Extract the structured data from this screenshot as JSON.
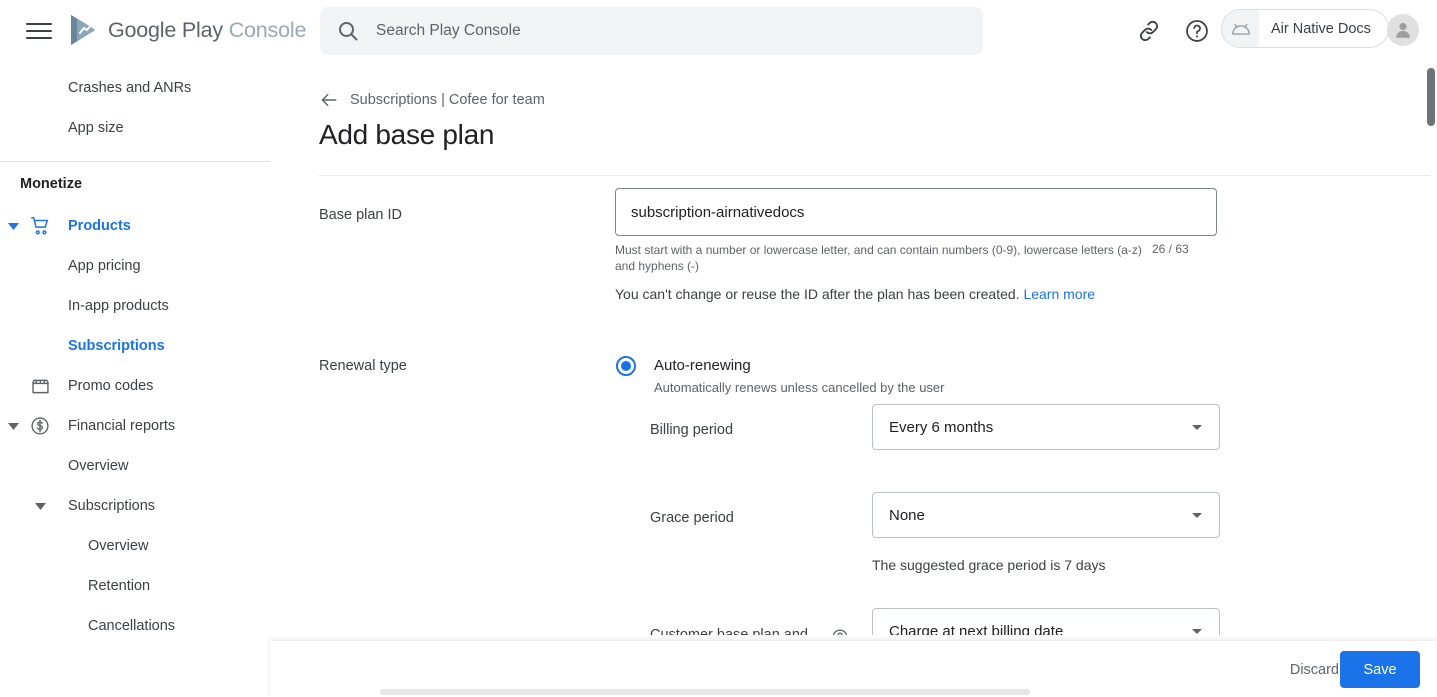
{
  "topbar": {
    "menu_icon": "hamburger-menu-icon",
    "brand_primary": "Google Play",
    "brand_secondary": "Console",
    "search": {
      "icon": "search-icon",
      "placeholder": "Search Play Console",
      "value": ""
    },
    "link_icon": "link-icon",
    "help_icon": "help-circle-icon",
    "app_chip": {
      "icon": "android-robot-icon",
      "label": "Air Native Docs"
    },
    "avatar": "user-avatar-icon"
  },
  "sidebar": {
    "top_items": [
      {
        "label": "Crashes and ANRs",
        "level": 2,
        "active": false,
        "icon": null,
        "caret": null
      },
      {
        "label": "App size",
        "level": 2,
        "active": false,
        "icon": null,
        "caret": null
      }
    ],
    "section_title": "Monetize",
    "items": [
      {
        "label": "Products",
        "level": 1,
        "active": true,
        "icon": "shopping-cart-icon",
        "caret": "expanded"
      },
      {
        "label": "App pricing",
        "level": 2,
        "active": false,
        "icon": null,
        "caret": null
      },
      {
        "label": "In-app products",
        "level": 2,
        "active": false,
        "icon": null,
        "caret": null
      },
      {
        "label": "Subscriptions",
        "level": 2,
        "active": true,
        "icon": null,
        "caret": null
      },
      {
        "label": "Promo codes",
        "level": 1,
        "active": false,
        "icon": "storefront-icon",
        "caret": null
      },
      {
        "label": "Financial reports",
        "level": 1,
        "active": false,
        "icon": "dollar-circle-icon",
        "caret": "expanded"
      },
      {
        "label": "Overview",
        "level": 2,
        "active": false,
        "icon": null,
        "caret": null
      },
      {
        "label": "Subscriptions",
        "level": 2,
        "active": false,
        "icon": null,
        "caret": "expanded-sub"
      },
      {
        "label": "Overview",
        "level": 3,
        "active": false,
        "icon": null,
        "caret": null
      },
      {
        "label": "Retention",
        "level": 3,
        "active": false,
        "icon": null,
        "caret": null
      },
      {
        "label": "Cancellations",
        "level": 3,
        "active": false,
        "icon": null,
        "caret": null
      }
    ]
  },
  "main": {
    "breadcrumb": {
      "back_icon": "arrow-left-icon",
      "text": "Subscriptions | Cofee for team"
    },
    "page_title": "Add base plan",
    "base_plan_id": {
      "label": "Base plan ID",
      "value": "subscription-airnativedocs",
      "placeholder": "",
      "helper": "Must start with a number or lowercase letter, and can contain numbers (0-9), lowercase letters (a-z) and hyphens (-)",
      "counter": "26 / 63",
      "note": "You can't change or reuse the ID after the plan has been created.",
      "note_link": "Learn more"
    },
    "renewal_type": {
      "label": "Renewal type",
      "option_title": "Auto-renewing",
      "option_sub": "Automatically renews unless cancelled by the user",
      "selected": true
    },
    "billing_period": {
      "label": "Billing period",
      "value": "Every 6 months",
      "dropdown_icon": "chevron-down-icon"
    },
    "grace_period": {
      "label": "Grace period",
      "value": "None",
      "hint": "The suggested grace period is 7 days",
      "dropdown_icon": "chevron-down-icon"
    },
    "customer_base_plan": {
      "label": "Customer base plan and",
      "help_icon": "help-circle-icon",
      "value": "Charge at next billing date",
      "dropdown_icon": "chevron-down-icon"
    }
  },
  "actionbar": {
    "discard_label": "Discard",
    "save_label": "Save"
  },
  "colors": {
    "accent": "#1a73e8",
    "text_primary": "#202124",
    "text_secondary": "#5f6368",
    "border": "#dadce0",
    "chrome_bg": "#f1f3f4"
  }
}
